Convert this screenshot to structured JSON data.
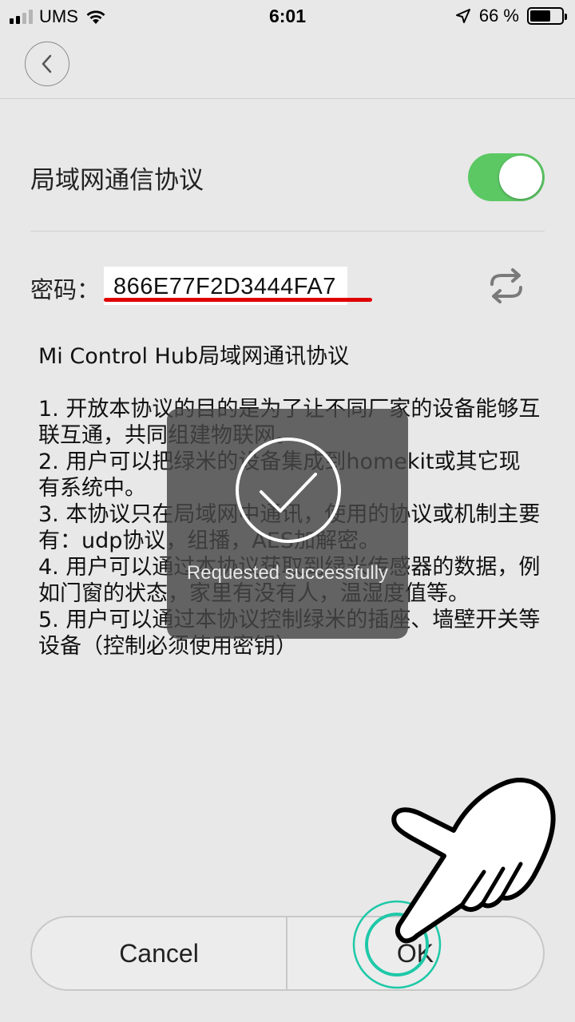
{
  "status_bar": {
    "carrier": "UMS",
    "time": "6:01",
    "battery_percent": "66 %",
    "battery_level": 0.66
  },
  "settings": {
    "lan_protocol_label": "局域网通信协议",
    "lan_protocol_enabled": true
  },
  "password": {
    "label": "密码：",
    "value": "866E77F2D3444FA7"
  },
  "protocol_text": "Mi Control Hub局域网通讯协议\n\n1. 开放本协议的目的是为了让不同厂家的设备能够互联互通，共同组建物联网。\n2. 用户可以把绿米的设备集成到homekit或其它现有系统中。\n3. 本协议只在局域网中通讯，使用的协议或机制主要有：udp协议，组播，AES加解密。\n4. 用户可以通过本协议获取到绿米传感器的数据，例如门窗的状态，家里有没有人，温湿度值等。\n5. 用户可以通过本协议控制绿米的插座、墙壁开关等设备（控制必须使用密钥）",
  "toast": {
    "message": "Requested successfully"
  },
  "buttons": {
    "cancel": "Cancel",
    "ok": "OK"
  },
  "colors": {
    "toggle_on": "#5cc864",
    "underline": "#e00000",
    "tap_ring": "#1ec8a8"
  }
}
